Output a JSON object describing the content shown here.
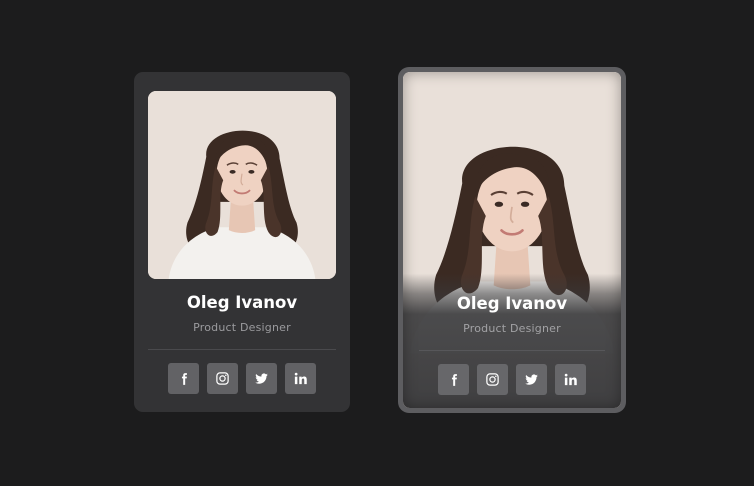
{
  "cards": [
    {
      "variant": "plain",
      "name": "Oleg Ivanov",
      "role": "Product Designer",
      "photo": "portrait-photo",
      "social": [
        {
          "icon": "facebook-icon",
          "label": "f"
        },
        {
          "icon": "instagram-icon",
          "label": ""
        },
        {
          "icon": "twitter-icon",
          "label": ""
        },
        {
          "icon": "linkedin-icon",
          "label": "in"
        }
      ]
    },
    {
      "variant": "overlay",
      "name": "Oleg Ivanov",
      "role": "Product Designer",
      "photo": "portrait-photo",
      "social": [
        {
          "icon": "facebook-icon",
          "label": "f"
        },
        {
          "icon": "instagram-icon",
          "label": ""
        },
        {
          "icon": "twitter-icon",
          "label": ""
        },
        {
          "icon": "linkedin-icon",
          "label": "in"
        }
      ]
    }
  ],
  "colors": {
    "page_background": "#1c1c1d",
    "card_background": "#333335",
    "card_border_overlay": "#5d5d60",
    "icon_button": "#626265",
    "text_primary": "#ffffff",
    "text_secondary": "#9b9b9e"
  }
}
